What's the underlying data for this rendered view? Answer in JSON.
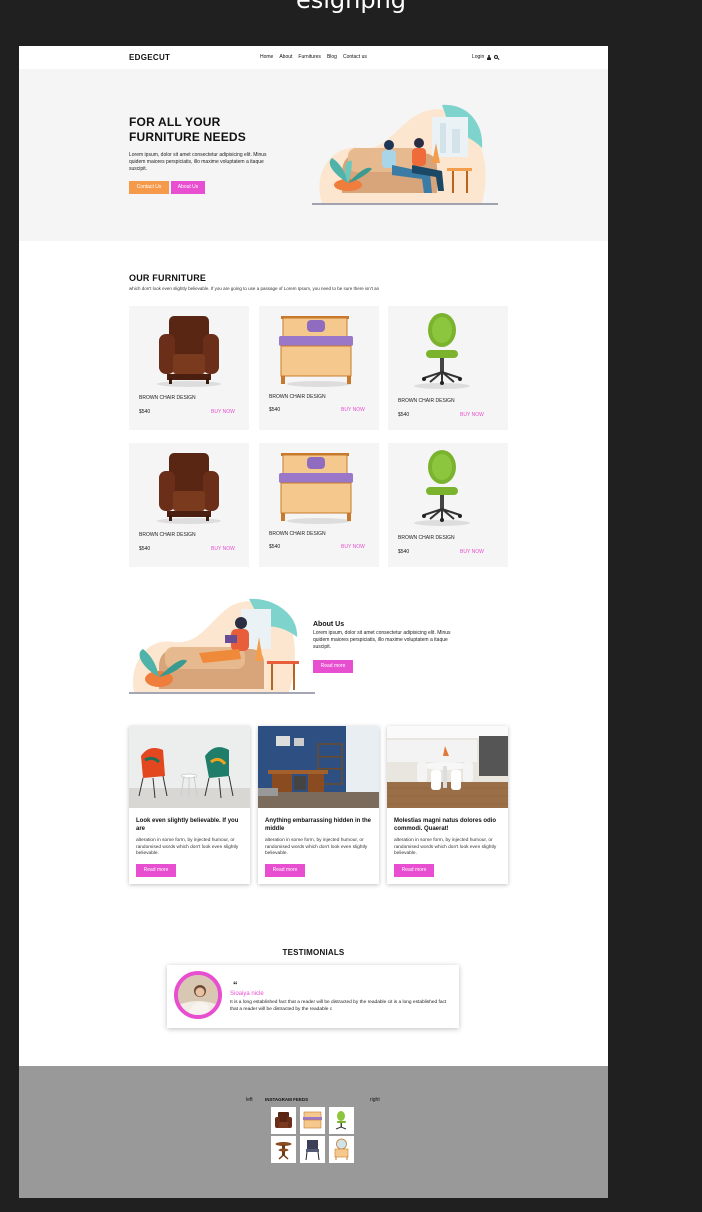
{
  "window": {
    "filename": "esignpng"
  },
  "header": {
    "logo": "EDGECUT",
    "nav": [
      "Home",
      "About",
      "Furnitures",
      "Blog",
      "Contact us"
    ],
    "login": "Login"
  },
  "hero": {
    "title_line1": "FOR ALL YOUR",
    "title_line2": "FURNITURE NEEDS",
    "text": "Lorem ipsum, dolor sit amet consectetur adipisicing elit. Minus quidem maiores perspiciatis, illo maxime voluptatem a itaque suscipit.",
    "btn_contact": "Contact Us",
    "btn_about": "About Us"
  },
  "furniture": {
    "title": "OUR FURNITURE",
    "subtitle": "which don't look even slightly believable. If you are going to use a passage of Lorem Ipsum, you need to be sure there isn't an",
    "items": [
      {
        "name": "BROWN CHAIR DESIGN",
        "price": "$540",
        "buy": "BUY NOW",
        "icon": "armchair"
      },
      {
        "name": "BROWN CHAIR DESIGN",
        "price": "$540",
        "buy": "BUY NOW",
        "icon": "bed"
      },
      {
        "name": "BROWN CHAIR DESIGN",
        "price": "$540",
        "buy": "BUY NOW",
        "icon": "office-chair"
      },
      {
        "name": "BROWN CHAIR DESIGN",
        "price": "$540",
        "buy": "BUY NOW",
        "icon": "armchair"
      },
      {
        "name": "BROWN CHAIR DESIGN",
        "price": "$540",
        "buy": "BUY NOW",
        "icon": "bed"
      },
      {
        "name": "BROWN CHAIR DESIGN",
        "price": "$540",
        "buy": "BUY NOW",
        "icon": "office-chair"
      }
    ]
  },
  "about": {
    "title": "About Us",
    "text": "Lorem ipsum, dolor sit amet consectetur adipisicing elit. Minus quidem maiores perspiciatis, illo maxime voluptatem a itaque suscipit.",
    "btn": "Read more"
  },
  "blog": [
    {
      "title": "Look even slightly believable. If you are",
      "text": "alteration in some form, by injected humour, or randomised words which don't look even slightly believable.",
      "btn": "Read more"
    },
    {
      "title": "Anything embarrassing hidden in the middle",
      "text": "alteration in some form, by injected humour, or randomised words which don't look even slightly believable.",
      "btn": "Read more"
    },
    {
      "title": "Molestias magni natus dolores odio commodi. Quaerat!",
      "text": "alteration in some form, by injected humour, or randomised words which don't look even slightly believable.",
      "btn": "Read more"
    }
  ],
  "testimonials": {
    "title": "TESTIMONIALS",
    "quote_mark": "“",
    "name": "Sioaiya nicle",
    "text": "It is a long established fact that a reader will be distracted by the readable cit is a long established fact that a reader will be distracted by the readable c"
  },
  "footer": {
    "left": "left",
    "title": "INSTAGRAM FEEDS",
    "right": "right",
    "thumbs": [
      "armchair",
      "bed",
      "office-chair",
      "side-table",
      "dining-chair",
      "dresser"
    ]
  },
  "colors": {
    "accent_pink": "#e84fd0",
    "accent_orange": "#f59a4a",
    "hero_bg": "#f5f5f5",
    "footer_bg": "#999999"
  }
}
